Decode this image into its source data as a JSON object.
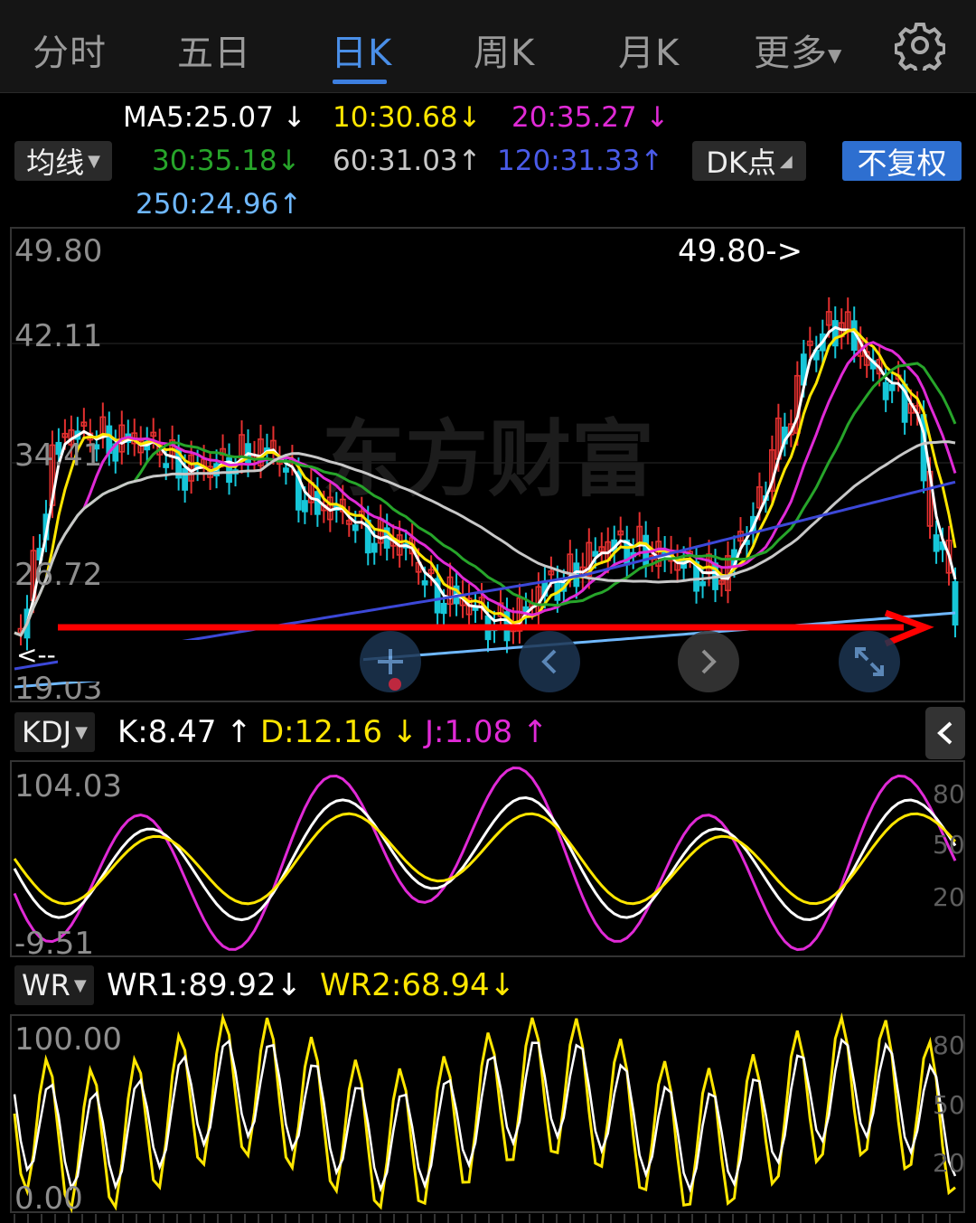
{
  "tabs": [
    "分时",
    "五日",
    "日K",
    "周K",
    "月K",
    "更多"
  ],
  "active_tab": "日K",
  "ma_panel": {
    "selector_label": "均线",
    "ma5": "MA5:25.07",
    "ma10": "10:30.68",
    "ma20": "20:35.27",
    "ma30": "30:35.18",
    "ma60": "60:31.03",
    "ma120": "120:31.33",
    "ma250": "250:24.96",
    "dk_label": "DK点",
    "adjust_label": "不复权"
  },
  "colors": {
    "up": "#e4302f",
    "down": "#16c6d8",
    "ma5": "#ffffff",
    "ma10": "#ffe600",
    "ma20": "#e02ad6",
    "ma30": "#27a52a",
    "ma60": "#c8c8c8",
    "ma120": "#3c48d8",
    "ma250": "#6fb8ff",
    "accent": "#3d7fe0",
    "arrow": "#ff0000"
  },
  "main_chart": {
    "y_labels": [
      "49.80",
      "42.11",
      "34.41",
      "26.72",
      "19.03"
    ],
    "max_marker": "49.80->",
    "left_marker": "<--",
    "watermark": "东方财富"
  },
  "kdj": {
    "selector_label": "KDJ",
    "k": "K:8.47",
    "d": "D:12.16",
    "j": "J:1.08",
    "y_top": "104.03",
    "y_bottom": "-9.51",
    "right_ticks": [
      "80",
      "50",
      "20"
    ]
  },
  "wr": {
    "selector_label": "WR",
    "wr1": "WR1:89.92",
    "wr2": "WR2:68.94",
    "y_top": "100.00",
    "y_bottom": "0.00",
    "right_ticks": [
      "80",
      "50",
      "20"
    ]
  },
  "arrows": {
    "up": "↑",
    "down": "↓"
  }
}
